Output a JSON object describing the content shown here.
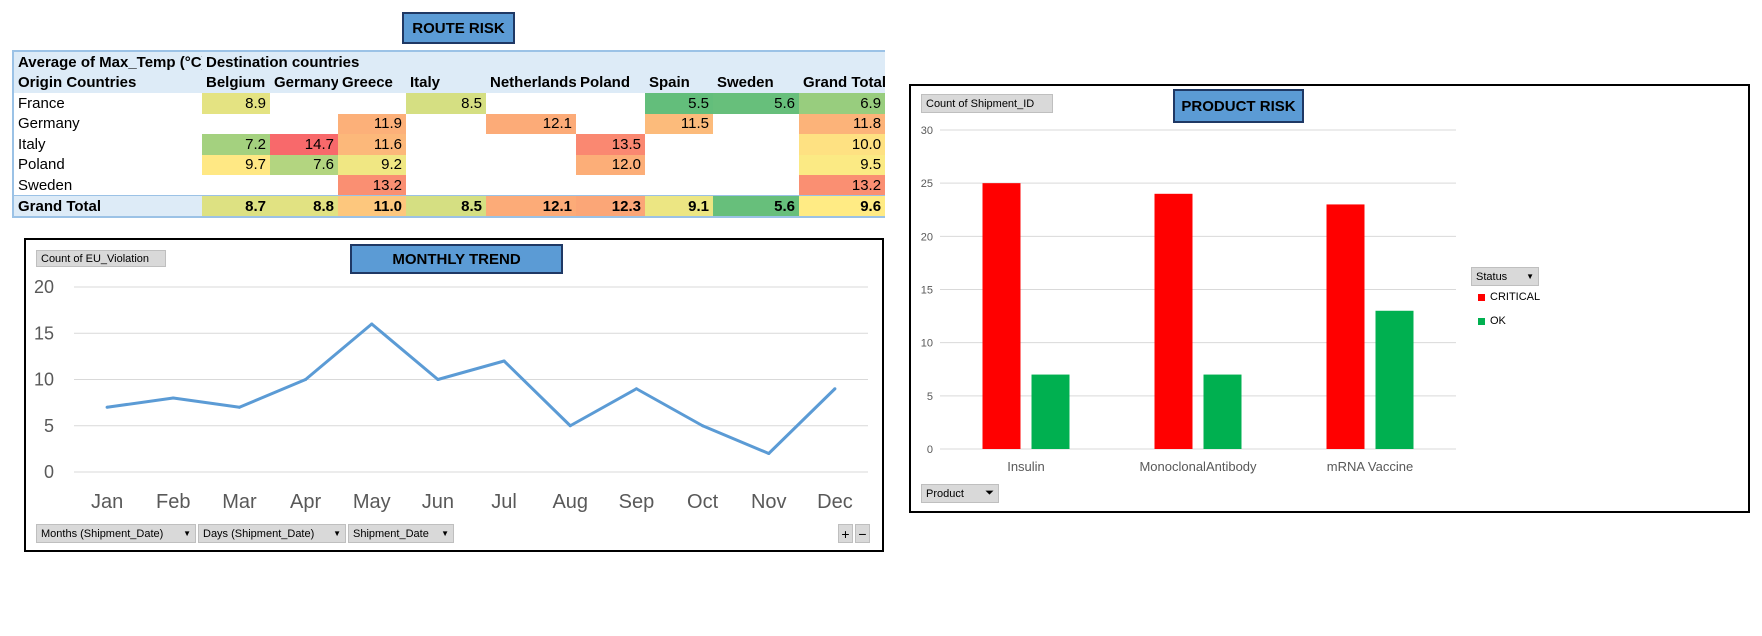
{
  "route_risk": {
    "title": "ROUTE RISK",
    "corner_label": "Average of Max_Temp (°C)",
    "col_field_label": "Destination countries",
    "row_field_label": "Origin Countries",
    "columns": [
      "Belgium",
      "Germany",
      "Greece",
      "Italy",
      "Netherlands",
      "Poland",
      "Spain",
      "Sweden",
      "Grand Total"
    ],
    "rows": [
      {
        "label": "France",
        "cells": [
          "8.9",
          "",
          "",
          "8.5",
          "",
          "",
          "5.5",
          "5.6",
          "6.9"
        ]
      },
      {
        "label": "Germany",
        "cells": [
          "",
          "",
          "11.9",
          "",
          "12.1",
          "",
          "11.5",
          "",
          "11.8"
        ]
      },
      {
        "label": "Italy",
        "cells": [
          "7.2",
          "14.7",
          "11.6",
          "",
          "",
          "13.5",
          "",
          "",
          "10.0"
        ]
      },
      {
        "label": "Poland",
        "cells": [
          "9.7",
          "7.6",
          "9.2",
          "",
          "",
          "12.0",
          "",
          "",
          "9.5"
        ]
      },
      {
        "label": "Sweden",
        "cells": [
          "",
          "",
          "13.2",
          "",
          "",
          "",
          "",
          "",
          "13.2"
        ]
      }
    ],
    "total": {
      "label": "Grand Total",
      "cells": [
        "8.7",
        "8.8",
        "11.0",
        "8.5",
        "12.1",
        "12.3",
        "9.1",
        "5.6",
        "9.6"
      ]
    }
  },
  "monthly_trend": {
    "title": "MONTHLY TREND",
    "value_field": "Count of EU_Violation",
    "filters": [
      "Months (Shipment_Date)",
      "Days (Shipment_Date)",
      "Shipment_Date"
    ],
    "plus": "+",
    "minus": "−"
  },
  "product_risk": {
    "title": "PRODUCT RISK",
    "value_field": "Count of Shipment_ID",
    "legend_title": "Status",
    "axis_field": "Product"
  },
  "colors": {
    "line": "#5b9bd5",
    "critical": "#ff0000",
    "ok": "#00b050",
    "header_bg": "#ddebf7",
    "title_bg": "#5b9bd5"
  },
  "chart_data": [
    {
      "type": "line",
      "title": "MONTHLY TREND",
      "ylabel": "Count of EU_Violation",
      "categories": [
        "Jan",
        "Feb",
        "Mar",
        "Apr",
        "May",
        "Jun",
        "Jul",
        "Aug",
        "Sep",
        "Oct",
        "Nov",
        "Dec"
      ],
      "series": [
        {
          "values": [
            7,
            8,
            7,
            10,
            16,
            10,
            12,
            5,
            9,
            5,
            2,
            9
          ]
        }
      ],
      "ylim": [
        0,
        20
      ],
      "yticks": [
        "0",
        "5",
        "10",
        "15",
        "20"
      ],
      "grid": true
    },
    {
      "type": "bar",
      "title": "PRODUCT RISK",
      "ylabel": "Count of Shipment_ID",
      "xlabel": "Product",
      "categories": [
        "Insulin",
        "MonoclonalAntibody",
        "mRNA Vaccine"
      ],
      "series": [
        {
          "name": "CRITICAL",
          "values": [
            25,
            24,
            23
          ]
        },
        {
          "name": "OK",
          "values": [
            7,
            7,
            13
          ]
        }
      ],
      "ylim": [
        0,
        30
      ],
      "yticks": [
        "0",
        "5",
        "10",
        "15",
        "20",
        "25",
        "30"
      ],
      "grid": true,
      "legend": "right"
    }
  ]
}
